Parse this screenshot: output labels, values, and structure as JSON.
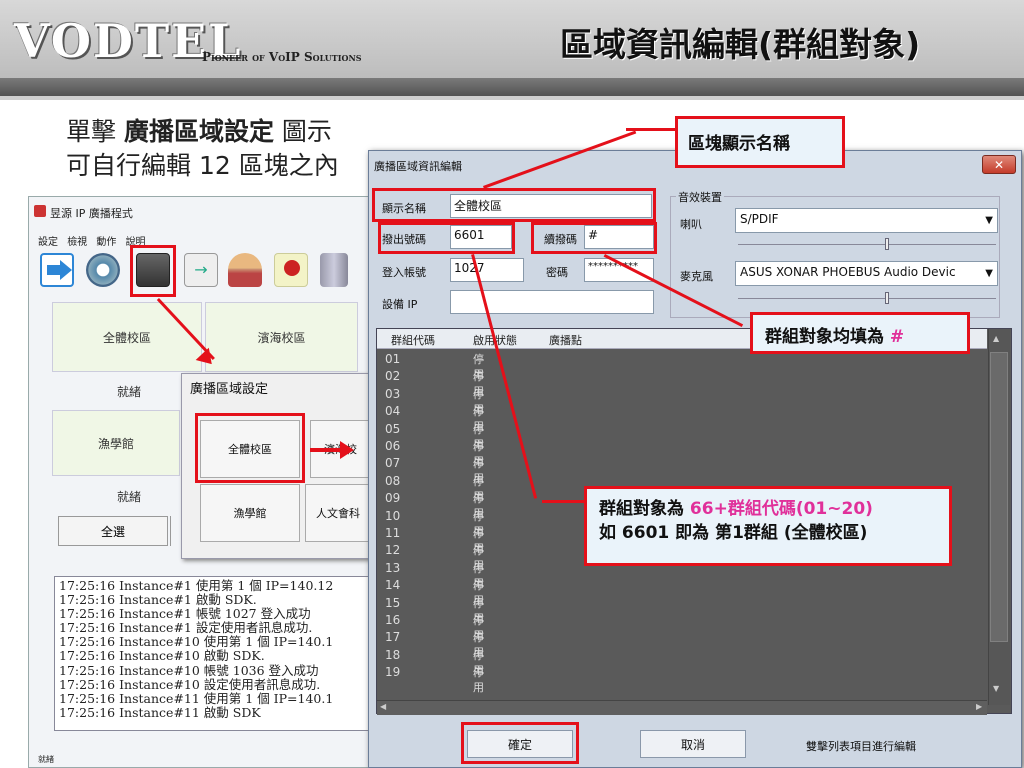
{
  "header": {
    "logo": "VODTEL",
    "tagline": "Pioneer of VoIP Solutions",
    "title": "區域資訊編輯(群組對象)"
  },
  "intro": {
    "line1_prefix": "單擊 ",
    "line1_bold": "廣播區域設定",
    "line1_suffix": " 圖示",
    "line2": "可自行編輯 12 區塊之內"
  },
  "app": {
    "title": "昱源 IP 廣播程式",
    "menu": [
      "設定",
      "檢視",
      "動作",
      "說明"
    ],
    "toolbar_icons": [
      "exit-icon",
      "settings-gear-icon",
      "broadcast-zone-icon",
      "transfer-icon",
      "user-icon",
      "pin-icon",
      "device-icon"
    ],
    "zones": [
      {
        "name": "全體校區",
        "status": "就緒"
      },
      {
        "name": "濱海校區",
        "status": ""
      },
      {
        "name": "漁學館",
        "status": "就緒"
      }
    ],
    "select_all": "全選",
    "log": [
      "17:25:16 Instance#1 使用第 1 個 IP=140.12",
      "17:25:16 Instance#1 啟動 SDK.",
      "17:25:16 Instance#1 帳號 1027 登入成功",
      "17:25:16 Instance#1 設定使用者訊息成功.",
      "17:25:16 Instance#10 使用第 1 個 IP=140.1",
      "17:25:16 Instance#10 啟動 SDK.",
      "17:25:16 Instance#10 帳號 1036 登入成功",
      "17:25:16 Instance#10 設定使用者訊息成功.",
      "17:25:16 Instance#11 使用第 1 個 IP=140.1",
      "17:25:16 Instance#11 啟動 SDK"
    ],
    "status": "就緒"
  },
  "zone_dialog": {
    "title": "廣播區域設定",
    "buttons": [
      "全體校區",
      "濱海校",
      "漁學館",
      "人文會科"
    ]
  },
  "edit_dialog": {
    "title": "廣播區域資訊編輯",
    "close": "✕",
    "display_name_label": "顯示名稱",
    "display_name": "全體校區",
    "dial_label": "撥出號碼",
    "dial": "6601",
    "continue_label": "續撥碼",
    "continue": "#",
    "login_label": "登入帳號",
    "login": "1027",
    "password_label": "密碼",
    "password": "**********",
    "device_ip_label": "設備 IP",
    "device_ip": "",
    "sound_group": "音效裝置",
    "speaker_label": "喇叭",
    "speaker": "S/PDIF",
    "mic_label": "麥克風",
    "mic": "ASUS XONAR PHOEBUS Audio Devic",
    "columns": [
      "群組代碼",
      "啟用狀態",
      "廣播點"
    ],
    "rows": [
      {
        "code": "01",
        "state": "停用"
      },
      {
        "code": "02",
        "state": "停用"
      },
      {
        "code": "03",
        "state": "停用"
      },
      {
        "code": "04",
        "state": "停用"
      },
      {
        "code": "05",
        "state": "停用"
      },
      {
        "code": "06",
        "state": "停用"
      },
      {
        "code": "07",
        "state": "停用"
      },
      {
        "code": "08",
        "state": "停用"
      },
      {
        "code": "09",
        "state": "停用"
      },
      {
        "code": "10",
        "state": "停用"
      },
      {
        "code": "11",
        "state": "停用"
      },
      {
        "code": "12",
        "state": "停用"
      },
      {
        "code": "13",
        "state": "停用"
      },
      {
        "code": "14",
        "state": "停用"
      },
      {
        "code": "15",
        "state": "停用"
      },
      {
        "code": "16",
        "state": "停用"
      },
      {
        "code": "17",
        "state": "停用"
      },
      {
        "code": "18",
        "state": "停用"
      },
      {
        "code": "19",
        "state": "停用"
      }
    ],
    "ok": "確定",
    "cancel": "取消",
    "hint": "雙擊列表項目進行編輯"
  },
  "callouts": {
    "name": "區塊顯示名稱",
    "group_prefix": "群組對象均填為 ",
    "group_hash": "#",
    "dial_line1_prefix": "群組對象為 ",
    "dial_line1_pink": "66+群組代碼(01~20)",
    "dial_line2": "如 6601 即為 第1群組 (全體校區)"
  },
  "colors": {
    "annotation_red": "#e4101a",
    "highlight_pink": "#e0309a"
  }
}
